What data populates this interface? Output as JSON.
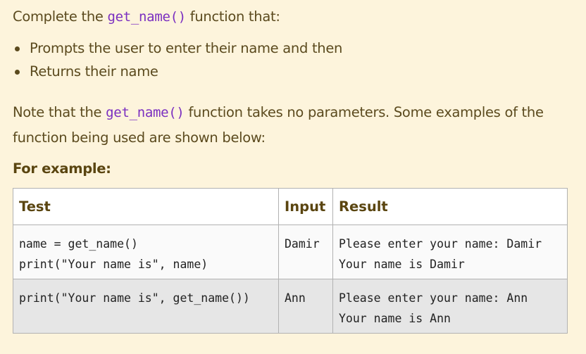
{
  "intro": {
    "before": "Complete the ",
    "code": "get_name()",
    "after": " function that:"
  },
  "bullets": [
    "Prompts the user to enter their name and then",
    "Returns their name"
  ],
  "note": {
    "before": "Note that the ",
    "code": "get_name()",
    "after": " function takes no parameters. Some examples of the",
    "line2": "function being used are shown below:"
  },
  "example_heading": "For example:",
  "table": {
    "headers": [
      "Test",
      "Input",
      "Result"
    ],
    "rows": [
      {
        "test": "name = get_name()\nprint(\"Your name is\", name)",
        "input": "Damir",
        "result": "Please enter your name: Damir\nYour name is Damir"
      },
      {
        "test": "print(\"Your name is\", get_name())",
        "input": "Ann",
        "result": "Please enter your name: Ann\nYour name is Ann"
      }
    ]
  }
}
